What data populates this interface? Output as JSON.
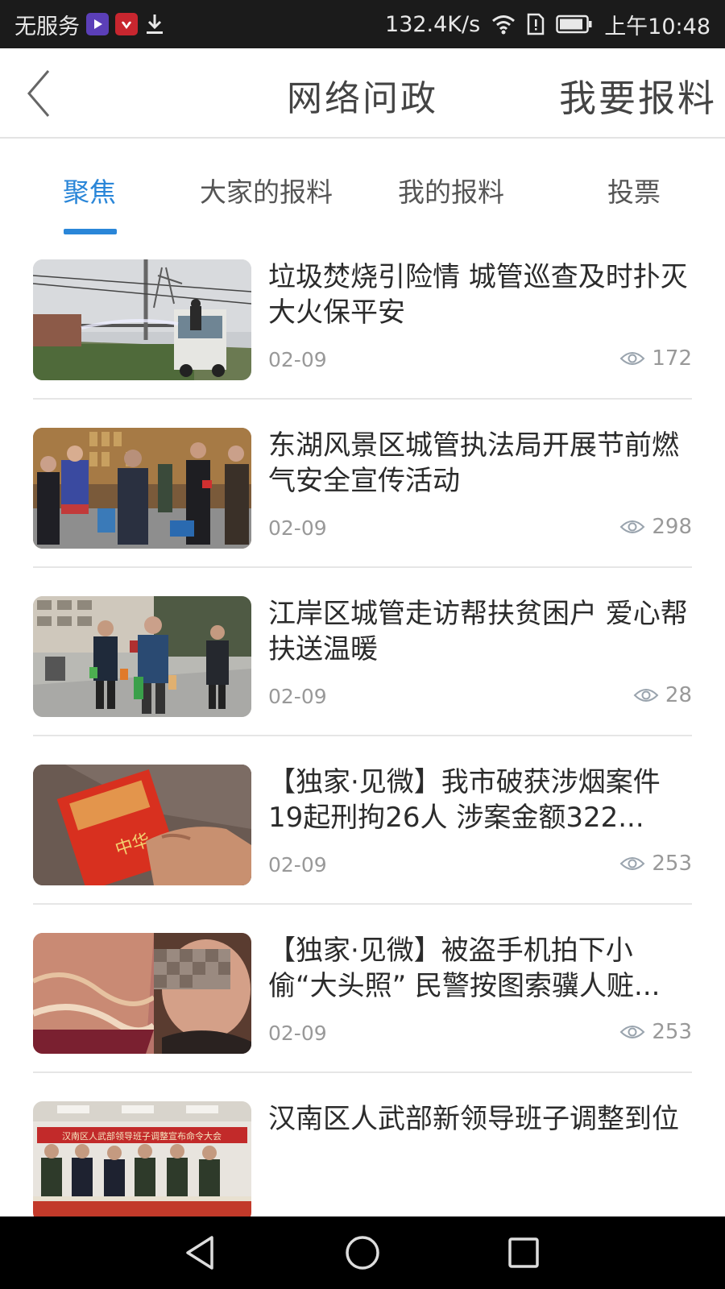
{
  "status_bar": {
    "carrier": "无服务",
    "net_speed": "132.4K/s",
    "time": "上午10:48",
    "icons": [
      "video-app-icon",
      "huawei-app-icon",
      "download-icon",
      "wifi-icon",
      "sim-alert-icon",
      "battery-icon"
    ]
  },
  "header": {
    "title": "网络问政",
    "action_label": "我要报料",
    "back_icon": "chevron-left-icon"
  },
  "tabs": [
    {
      "label": "聚焦",
      "active": true
    },
    {
      "label": "大家的报料",
      "active": false
    },
    {
      "label": "我的报料",
      "active": false
    },
    {
      "label": "投票",
      "active": false
    }
  ],
  "colors": {
    "accent": "#2a86d8",
    "status_bar_bg": "#1b1b1b",
    "nav_bar_bg": "#000000",
    "divider": "#e6e6e6",
    "meta_text": "#999999"
  },
  "articles": [
    {
      "title": "垃圾焚烧引险情 城管巡查及时扑灭大火保平安",
      "date": "02-09",
      "views": "172",
      "thumbnail": "fire-truck-photo"
    },
    {
      "title": "东湖风景区城管执法局开展节前燃气安全宣传活动",
      "date": "02-09",
      "views": "298",
      "thumbnail": "shop-inspection-photo"
    },
    {
      "title": "江岸区城管走访帮扶贫困户 爱心帮扶送温暖",
      "date": "02-09",
      "views": "28",
      "thumbnail": "street-visit-photo"
    },
    {
      "title": "【独家·见微】我市破获涉烟案件19起刑拘26人 涉案金额322...",
      "date": "02-09",
      "views": "253",
      "thumbnail": "cigarette-pack-photo"
    },
    {
      "title": "【独家·见微】被盗手机拍下小偷“大头照” 民警按图索骥人赃...",
      "date": "02-09",
      "views": "253",
      "thumbnail": "blurred-face-photo"
    },
    {
      "title": "汉南区人武部新领导班子调整到位",
      "date": "",
      "views": "",
      "thumbnail": "meeting-photo"
    }
  ],
  "meeting_banner": "汉南区人武部领导班子调整宣布命令大会",
  "nav": {
    "back_icon": "back-triangle-icon",
    "home_icon": "home-circle-icon",
    "recents_icon": "recents-square-icon"
  }
}
